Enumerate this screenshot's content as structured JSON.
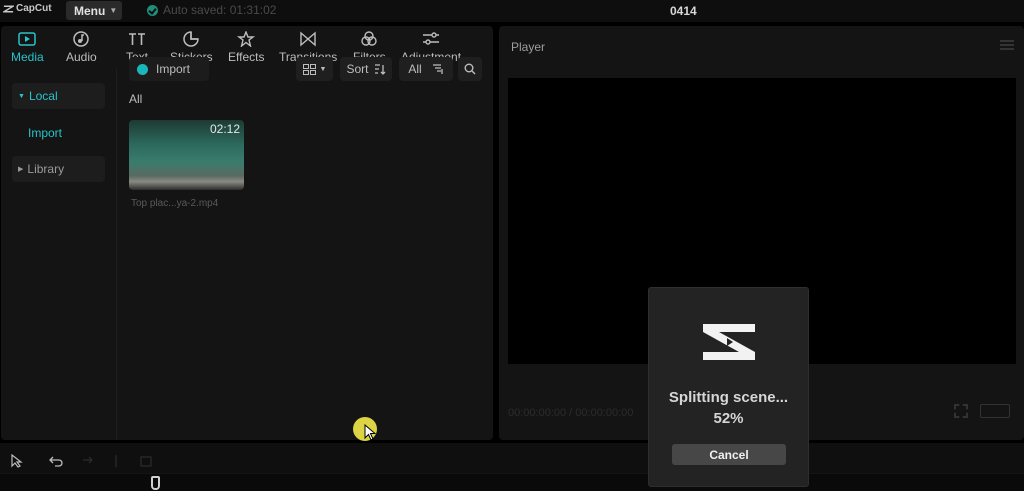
{
  "app": {
    "logo_text": "CapCut",
    "menu_label": "Menu",
    "autosave_text": "Auto saved: 01:31:02",
    "project_title": "0414"
  },
  "toolbar": {
    "tabs": [
      {
        "label": "Media",
        "icon": "media-icon",
        "active": true
      },
      {
        "label": "Audio",
        "icon": "audio-icon",
        "active": false
      },
      {
        "label": "Text",
        "icon": "text-icon",
        "active": false
      },
      {
        "label": "Stickers",
        "icon": "stickers-icon",
        "active": false
      },
      {
        "label": "Effects",
        "icon": "effects-icon",
        "active": false
      },
      {
        "label": "Transitions",
        "icon": "transitions-icon",
        "active": false
      },
      {
        "label": "Filters",
        "icon": "filters-icon",
        "active": false
      },
      {
        "label": "Adjustment",
        "icon": "adjustment-icon",
        "active": false
      }
    ]
  },
  "sidebar": {
    "local": "Local",
    "import": "Import",
    "library": "Library"
  },
  "media": {
    "import_label": "Import",
    "sort_label": "Sort",
    "filter_label": "All",
    "section_label": "All",
    "items": [
      {
        "name": "Top plac...ya-2.mp4",
        "duration": "02:12"
      }
    ]
  },
  "player": {
    "title": "Player",
    "timecode": "00:00:00:00 / 00:00:00:00"
  },
  "modal": {
    "title": "Splitting scene...",
    "progress": "52%",
    "cancel_label": "Cancel"
  },
  "colors": {
    "accent": "#27c4c9",
    "background": "#000000",
    "panel": "#141414",
    "modal": "#232323"
  }
}
